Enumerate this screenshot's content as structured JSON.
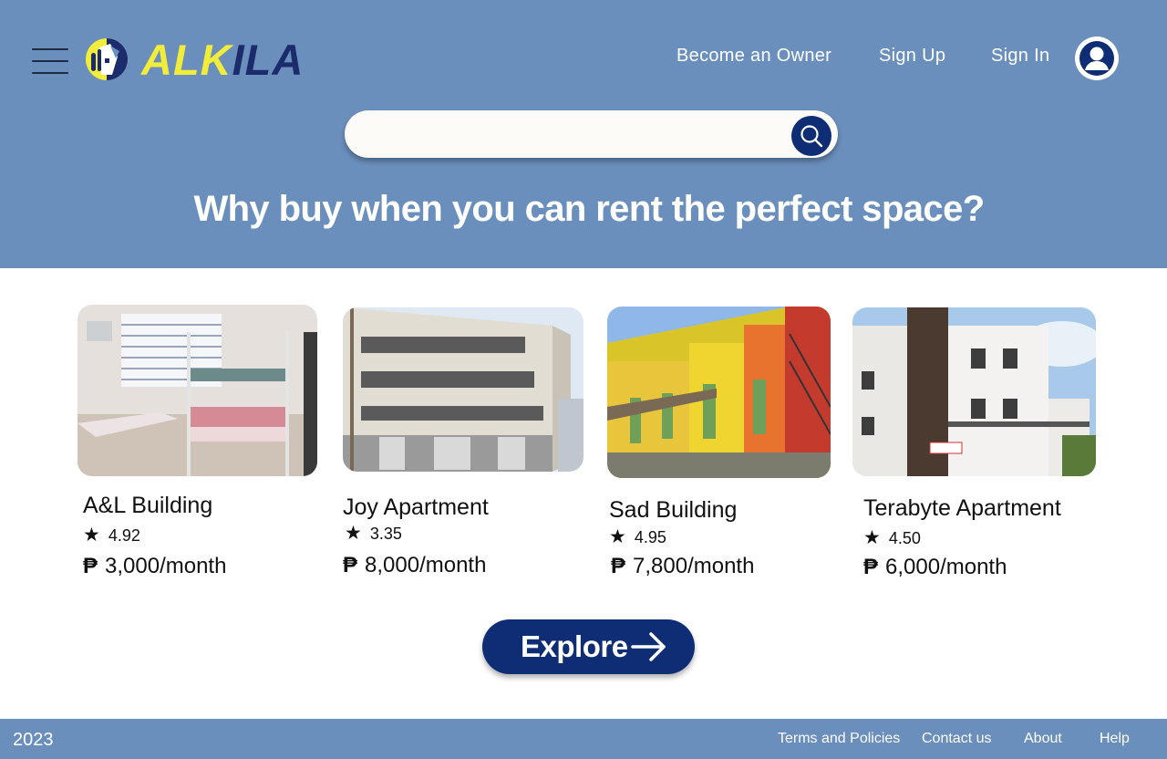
{
  "app": {
    "logo_part1": "ALK",
    "logo_part2": "ILA"
  },
  "nav": {
    "become_owner": "Become an Owner",
    "sign_up": "Sign Up",
    "sign_in": "Sign In"
  },
  "search": {
    "placeholder": "",
    "value": ""
  },
  "hero": {
    "headline": "Why buy when you can rent the perfect space?"
  },
  "listings": [
    {
      "name": "A&L Building",
      "rating": "4.92",
      "price": "3,000/month",
      "currency": "₱"
    },
    {
      "name": "Joy Apartment",
      "rating": "3.35",
      "price": "8,000/month",
      "currency": "₱"
    },
    {
      "name": "Sad Building",
      "rating": "4.95",
      "price": "7,800/month",
      "currency": "₱"
    },
    {
      "name": "Terabyte Apartment",
      "rating": "4.50",
      "price": "6,000/month",
      "currency": "₱"
    }
  ],
  "explore": {
    "label": "Explore"
  },
  "footer": {
    "year": "2023",
    "links": [
      "Terms and Policies",
      "Contact us",
      "About",
      "Help"
    ]
  },
  "icons": {
    "menu": "hamburger-menu-icon",
    "logo": "alkila-logo-icon",
    "avatar": "user-avatar-icon",
    "search": "search-icon",
    "star": "star-icon",
    "arrow": "arrow-right-icon"
  },
  "colors": {
    "header_bg": "#6a8fbc",
    "accent_dark": "#0f2d74",
    "logo_yellow": "#f2ec3a",
    "logo_navy": "#1b2b6b"
  }
}
